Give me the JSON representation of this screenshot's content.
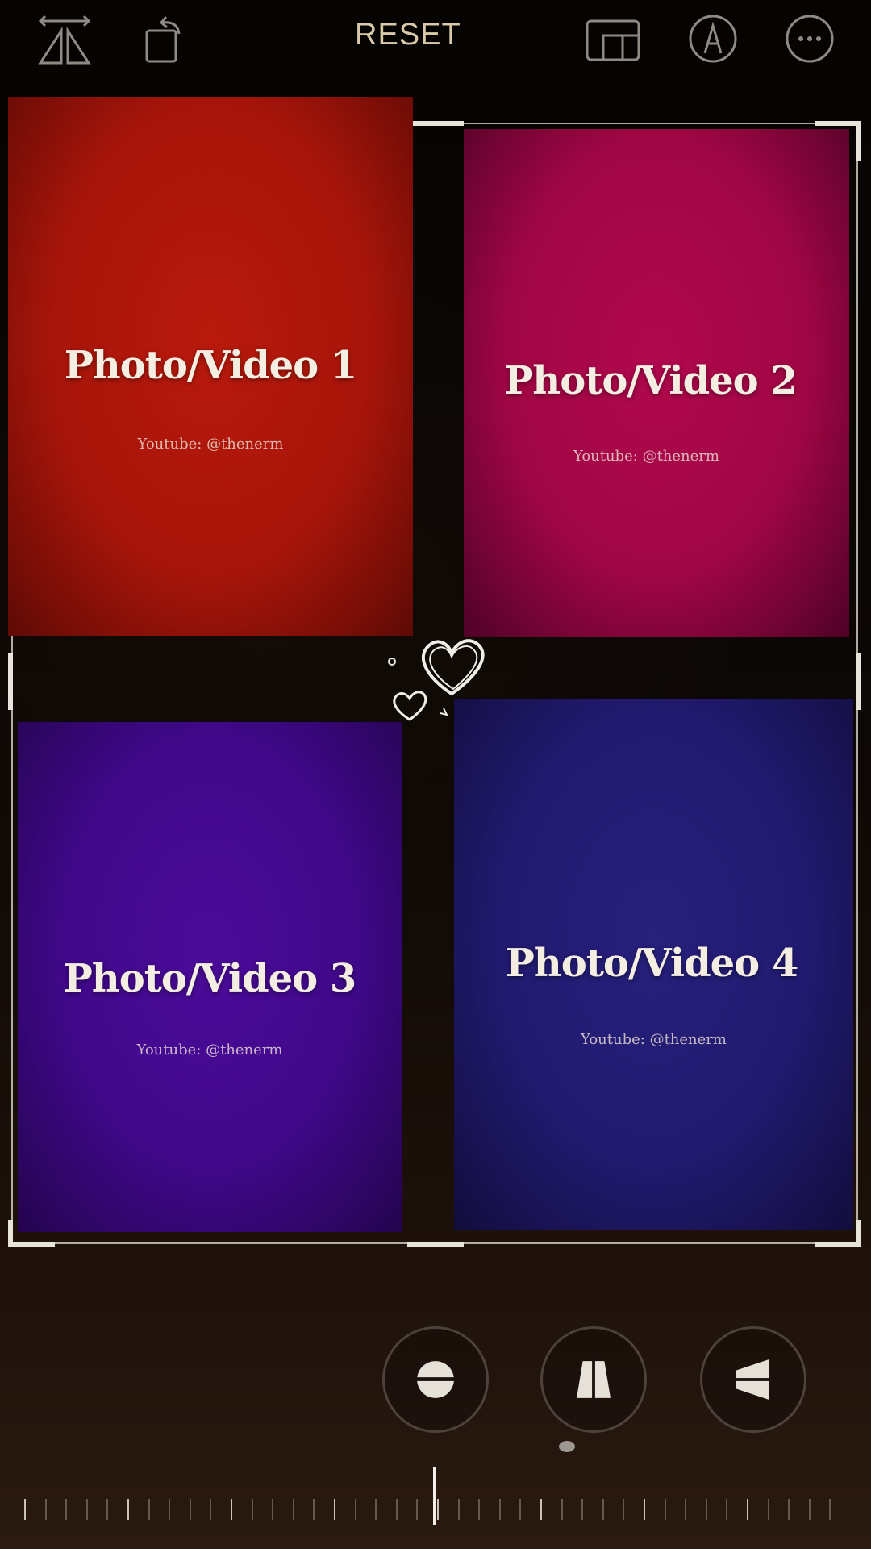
{
  "toolbar": {
    "reset_label": "RESET",
    "icons": [
      "flip-horizontal-icon",
      "rotate-icon",
      "aspect-ratio-icon",
      "markup-pen-icon",
      "more-options-icon"
    ]
  },
  "collage": {
    "tiles": [
      {
        "title": "Photo/Video 1",
        "subtitle": "Youtube: @thenerm"
      },
      {
        "title": "Photo/Video 2",
        "subtitle": "Youtube: @thenerm"
      },
      {
        "title": "Photo/Video 3",
        "subtitle": "Youtube: @thenerm"
      },
      {
        "title": "Photo/Video 4",
        "subtitle": "Youtube: @thenerm"
      }
    ],
    "colors": {
      "tile1": "#a8150a",
      "tile2": "#a00644",
      "tile3": "#3f0888",
      "tile4": "#211a6f"
    }
  },
  "adjustments": {
    "buttons": [
      "straighten-icon",
      "vertical-perspective-icon",
      "horizontal-perspective-icon"
    ]
  },
  "accent": "#d8c9a8"
}
